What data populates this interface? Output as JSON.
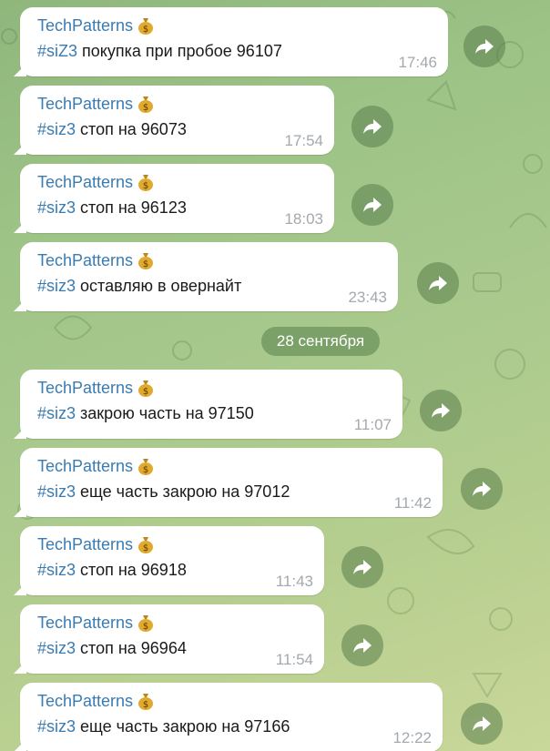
{
  "date_separator": "28 сентября",
  "messages": [
    {
      "sender": "TechPatterns",
      "tag": "#siZ3",
      "text": " покупка при пробое 96107",
      "time": "17:46"
    },
    {
      "sender": "TechPatterns",
      "tag": "#siz3",
      "text": " стоп на 96073",
      "time": "17:54"
    },
    {
      "sender": "TechPatterns",
      "tag": "#siz3",
      "text": " стоп на 96123",
      "time": "18:03"
    },
    {
      "sender": "TechPatterns",
      "tag": "#siz3",
      "text": " оставляю в овернайт",
      "time": "23:43"
    },
    {
      "sender": "TechPatterns",
      "tag": "#siz3",
      "text": " закрою часть на 97150",
      "time": "11:07"
    },
    {
      "sender": "TechPatterns",
      "tag": "#siz3",
      "text": " еще часть закрою на 97012",
      "time": "11:42"
    },
    {
      "sender": "TechPatterns",
      "tag": "#siz3",
      "text": " стоп на 96918",
      "time": "11:43"
    },
    {
      "sender": "TechPatterns",
      "tag": "#siz3",
      "text": " стоп на 96964",
      "time": "11:54"
    },
    {
      "sender": "TechPatterns",
      "tag": "#siz3",
      "text": " еще часть закрою на 97166",
      "time": "12:22"
    }
  ],
  "icons": {
    "sender_badge": "money-bag-icon",
    "forward": "forward-arrow-icon"
  },
  "colors": {
    "accent": "#3a7bb0",
    "time": "#a3a9ae",
    "bubble": "#ffffff"
  }
}
